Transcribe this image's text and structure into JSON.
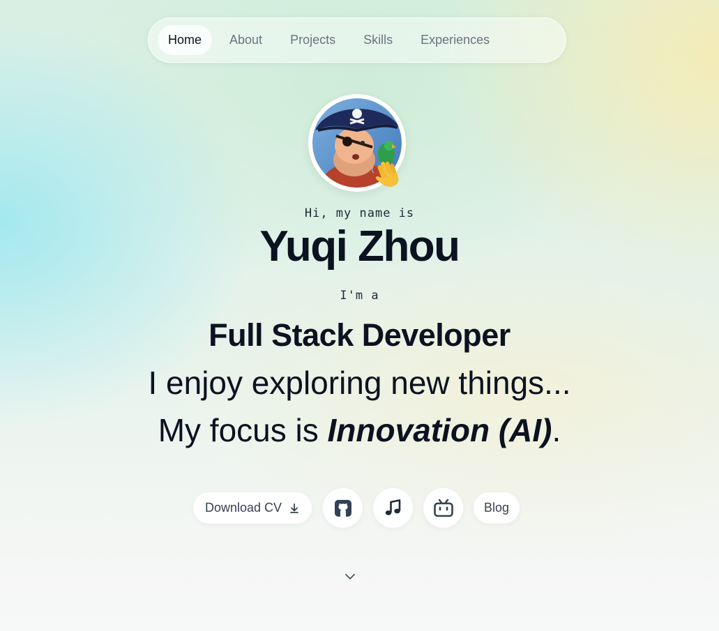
{
  "nav": {
    "items": [
      {
        "label": "Home",
        "active": true
      },
      {
        "label": "About"
      },
      {
        "label": "Projects"
      },
      {
        "label": "Skills"
      },
      {
        "label": "Experiences"
      }
    ]
  },
  "hero": {
    "avatar_icon": "pirate-avatar",
    "wave_icon": "waving-hand-icon",
    "intro": "Hi, my name is",
    "name": "Yuqi Zhou",
    "im_a": "I'm a",
    "role": "Full Stack Developer",
    "tagline": "I enjoy exploring new things...",
    "focus_prefix": "My focus is ",
    "focus_emphasis": "Innovation (AI)",
    "focus_suffix": "."
  },
  "actions": {
    "download_cv": "Download CV",
    "blog": "Blog",
    "icons": [
      "download-icon",
      "github-icon",
      "music-note-icon",
      "bilibili-icon",
      "chevron-down-icon"
    ]
  },
  "colors": {
    "text": "#0b1220",
    "muted": "#6b7280",
    "icon": "#334155"
  }
}
